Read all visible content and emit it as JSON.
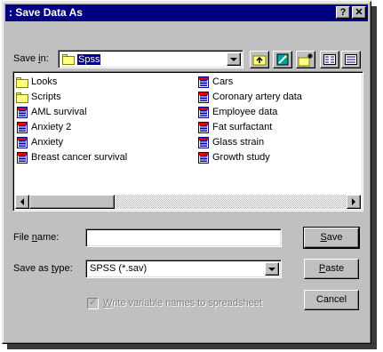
{
  "dialog": {
    "title": ": Save Data As",
    "help_btn": "?",
    "close_btn": "✕"
  },
  "save_in": {
    "label_prefix": "Save ",
    "label_accel": "i",
    "label_suffix": "n:",
    "value": "Spss",
    "icon": "folder-icon"
  },
  "toolbar": {
    "up_icon": "up-folder-icon",
    "desktop_icon": "desktop-icon",
    "new_folder_icon": "new-folder-icon",
    "list_icon": "list-view-icon",
    "details_icon": "details-view-icon"
  },
  "files": {
    "left": [
      {
        "name": "Looks",
        "type": "folder"
      },
      {
        "name": "Scripts",
        "type": "folder"
      },
      {
        "name": "AML survival",
        "type": "sav"
      },
      {
        "name": "Anxiety 2",
        "type": "sav"
      },
      {
        "name": "Anxiety",
        "type": "sav"
      },
      {
        "name": "Breast cancer survival",
        "type": "sav"
      }
    ],
    "right": [
      {
        "name": "Cars",
        "type": "sav"
      },
      {
        "name": "Coronary artery data",
        "type": "sav"
      },
      {
        "name": "Employee data",
        "type": "sav"
      },
      {
        "name": "Fat surfactant",
        "type": "sav"
      },
      {
        "name": "Glass strain",
        "type": "sav"
      },
      {
        "name": "Growth study",
        "type": "sav"
      }
    ]
  },
  "file_name": {
    "label_prefix": "File ",
    "label_accel": "n",
    "label_suffix": "ame:",
    "value": ""
  },
  "save_as_type": {
    "label_prefix": "Save as ",
    "label_accel": "t",
    "label_suffix": "ype:",
    "value": "SPSS (*.sav)"
  },
  "checkbox": {
    "checked": true,
    "disabled": true,
    "label_accel": "W",
    "label_rest": "rite variable names to spreadsheet"
  },
  "buttons": {
    "save_accel": "S",
    "save_rest": "ave",
    "paste_accel": "P",
    "paste_rest": "aste",
    "cancel": "Cancel"
  }
}
